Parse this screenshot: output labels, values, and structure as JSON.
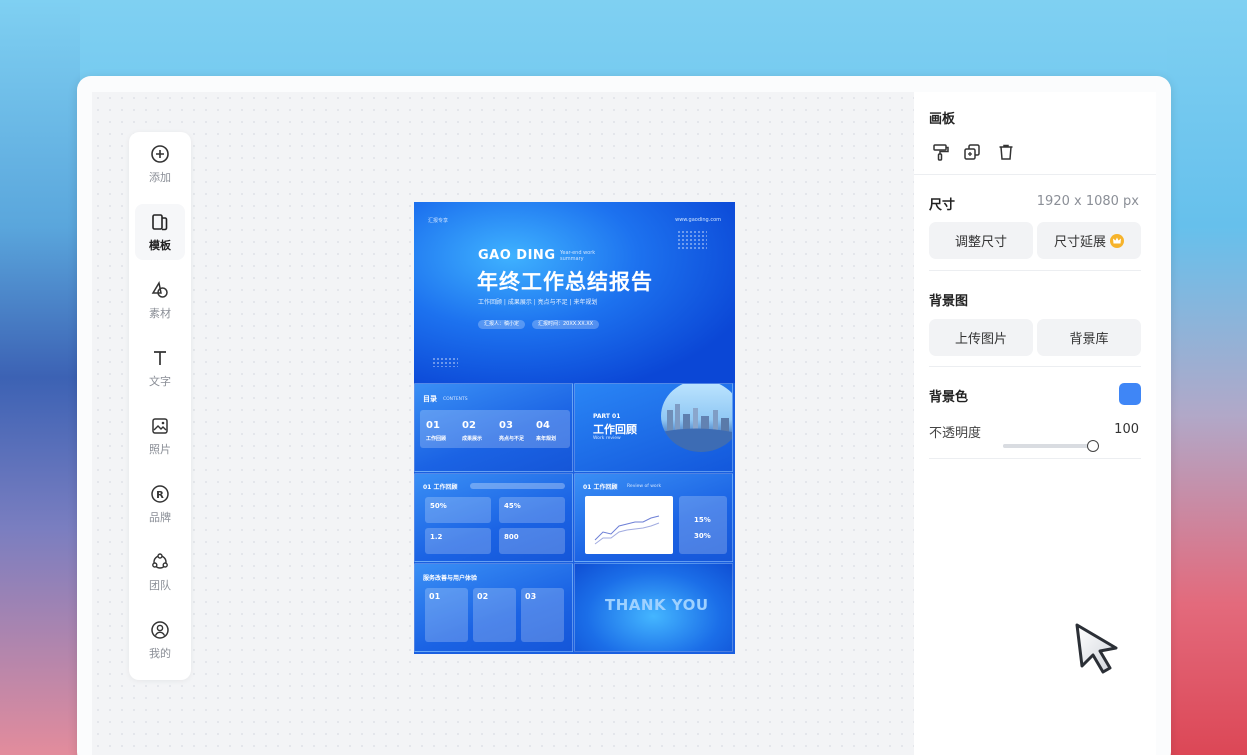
{
  "toolbar": {
    "items": [
      {
        "label": "添加",
        "icon": "add-circle-icon"
      },
      {
        "label": "模板",
        "icon": "template-icon"
      },
      {
        "label": "素材",
        "icon": "shapes-icon"
      },
      {
        "label": "文字",
        "icon": "text-icon"
      },
      {
        "label": "照片",
        "icon": "image-icon"
      },
      {
        "label": "品牌",
        "icon": "brand-r-icon"
      },
      {
        "label": "团队",
        "icon": "team-icon"
      },
      {
        "label": "我的",
        "icon": "user-icon"
      }
    ],
    "active": "模板"
  },
  "document": {
    "hero": {
      "top_left": "汇报专享",
      "top_right": "www.gaoding.com",
      "brand": "GAO DING",
      "brand_sub": "Year-end work summary",
      "title": "年终工作总结报告",
      "tags": "工作回顾 | 成果展示 | 亮点与不足 | 来年规划",
      "reporter": "汇报人：稿小定",
      "date": "汇报时间：20XX.XX.XX"
    },
    "toc": {
      "title": "目录",
      "title_en": "CONTENTS",
      "items": [
        {
          "num": "01",
          "label": "工作回顾"
        },
        {
          "num": "02",
          "label": "成果展示"
        },
        {
          "num": "03",
          "label": "亮点与不足"
        },
        {
          "num": "04",
          "label": "来年规划"
        }
      ]
    },
    "part": {
      "label": "PART 01",
      "title": "工作回顾",
      "sub": "Work review"
    },
    "review": {
      "title": "01 工作回顾",
      "stats": [
        "50%",
        "45%",
        "1.2",
        "800"
      ]
    },
    "review_chart": {
      "title": "01 工作回顾",
      "sub": "Review of work",
      "values": [
        "15%",
        "30%"
      ]
    },
    "service": {
      "title": "服务改善与用户体验",
      "items": [
        "01",
        "02",
        "03"
      ]
    },
    "thanks": {
      "text": "THANK YOU"
    }
  },
  "panel": {
    "artboard_title": "画板",
    "size_label": "尺寸",
    "size_value": "1920 x 1080 px",
    "resize_btn": "调整尺寸",
    "extend_btn": "尺寸延展",
    "bg_image_label": "背景图",
    "upload_btn": "上传图片",
    "library_btn": "背景库",
    "bg_color_label": "背景色",
    "bg_color": "#3f86f6",
    "opacity_label": "不透明度",
    "opacity_value": "100"
  },
  "colors": {
    "accent": "#3f86f6",
    "doc_blue": "#1a5fe0"
  }
}
